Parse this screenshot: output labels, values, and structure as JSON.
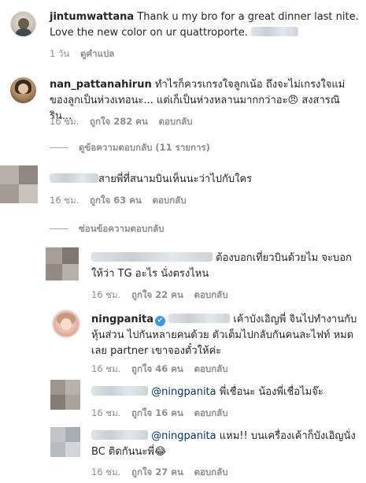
{
  "comments": [
    {
      "username": "jintumwattana",
      "text": "Thank u my bro for a great dinner last nite. Love the new color on ur quattroporte.",
      "time": "1 วัน",
      "translate": "ดูคำแปล"
    },
    {
      "username": "nan_pattanahirun",
      "text": "ทำไรก็ควรเกรงใจลูกเน้อ ถึงจะไม่เกรงใจแม่ของลูกเป็นห่วงเทอนะ... แต่เก็เป็นห่วงหลานมากกว่าอะ😠 สงสารณิริน...",
      "time": "16 ชม.",
      "likes": "ถูกใจ 282 คน",
      "reply": "ตอบกลับ",
      "view_replies": "ดูข้อความตอบกลับ (11 รายการ)"
    },
    {
      "username": "",
      "text": "สายพี่ที่สนามบินเห็นนะว่าไปกับใคร",
      "time": "16 ชม.",
      "likes": "ถูกใจ 63 คน",
      "reply": "ตอบกลับ",
      "hide_replies": "ซ่อนข้อความตอบกลับ"
    }
  ],
  "replies": [
    {
      "username": "",
      "text": "ต้องบอกเที่ยวบินด้วยไม จะบอกให้ว่า TG อะไร นั่งตรงไหน",
      "time": "16 ชม.",
      "likes": "ถูกใจ 22 คน",
      "reply": "ตอบกลับ"
    },
    {
      "username": "ningpanita",
      "verified": "✔",
      "text": "เค้าบังเอิญพี่ จินไปทำงานกับหุ้นส่วน ไปกันหลายคนด้วย ตัวเต็มไปกลับกันคนละไฟท์ หมดเลย partner เขาจองตั๋วให้ค่ะ",
      "time": "16 ชม.",
      "likes": "ถูกใจ 46 คน",
      "reply": "ตอบกลับ"
    },
    {
      "username": "",
      "mention": "@ningpanita",
      "text": "พี่เชื่อนะ น้องพี่เชื่อไมจ๊ะ",
      "time": "16 ชม.",
      "likes": "ถูกใจ 16 คน",
      "reply": "ตอบกลับ"
    },
    {
      "username": "",
      "mention": "@ningpanita",
      "text": "แหม!! บนเครื่องเค้าก็บังเอิญนั่ง BC ติดกันนะพี่😂",
      "time": "16 ชม.",
      "likes": "ถูกใจ 27 คน",
      "reply": "ตอบกลับ"
    }
  ]
}
